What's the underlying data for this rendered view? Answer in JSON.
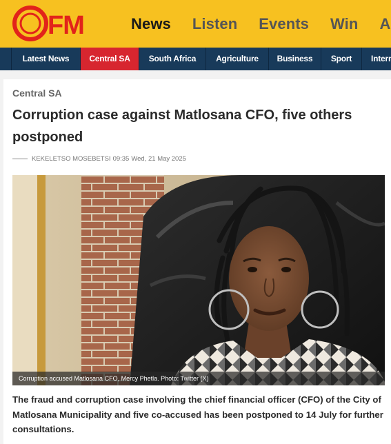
{
  "header": {
    "logo_text": "OFM",
    "nav": [
      {
        "label": "News",
        "active": true
      },
      {
        "label": "Listen",
        "active": false
      },
      {
        "label": "Events",
        "active": false
      },
      {
        "label": "Win",
        "active": false
      },
      {
        "label": "Adv",
        "active": false
      }
    ]
  },
  "categories": [
    {
      "label": "Latest News",
      "active": false
    },
    {
      "label": "Central SA",
      "active": true
    },
    {
      "label": "South Africa",
      "active": false
    },
    {
      "label": "Agriculture",
      "active": false
    },
    {
      "label": "Business",
      "active": false
    },
    {
      "label": "Sport",
      "active": false
    },
    {
      "label": "Intern",
      "active": false
    }
  ],
  "article": {
    "category": "Central SA",
    "title": "Corruption case against Matlosana CFO, five others postponed",
    "author": "KEKELETSO MOSEBETSI",
    "time": "09:35",
    "date": "Wed, 21 May 2025",
    "image_caption": "Corruption accused Matlosana CFO, Mercy Phetla. Photo: Twitter (X)",
    "lead": "The fraud and corruption case involving the chief financial officer (CFO) of the City of Matlosana Municipality and five co-accused has been postponed to 14 July for further consultations."
  },
  "colors": {
    "brand_yellow": "#f7c120",
    "logo_red": "#e2231a",
    "nav_navy": "#183a5a",
    "active_red": "#d7262f"
  }
}
